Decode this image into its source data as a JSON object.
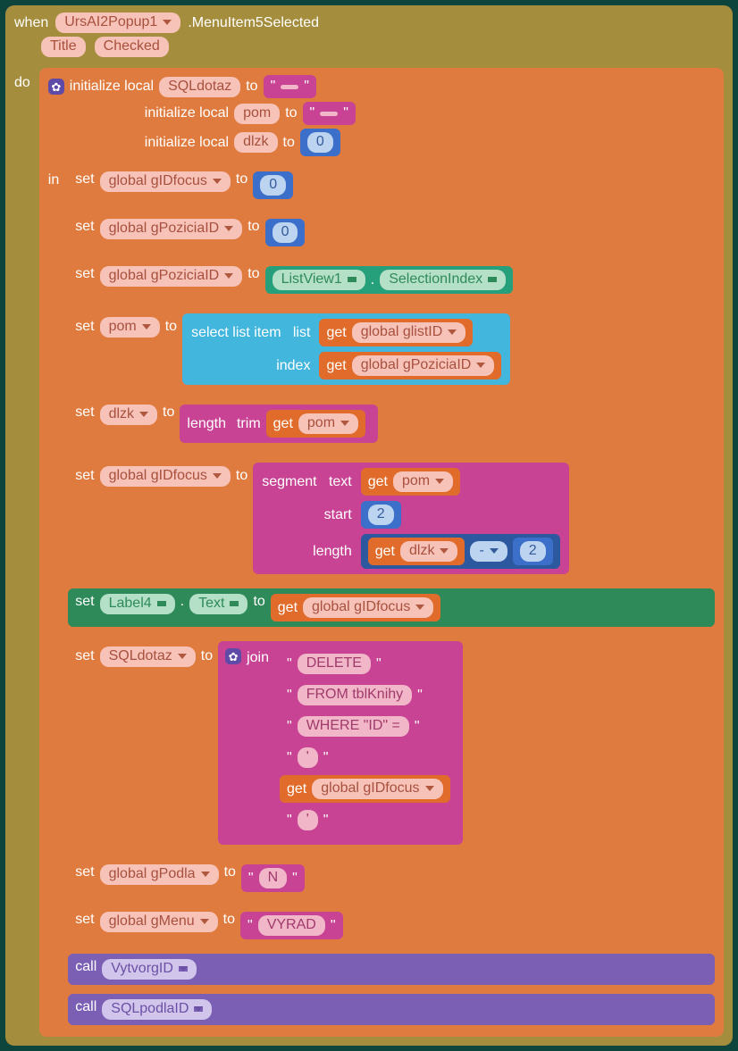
{
  "header": {
    "when": "when",
    "component": "UrsAI2Popup1",
    "event": ".MenuItem5Selected",
    "params": [
      "Title",
      "Checked"
    ],
    "do": "do"
  },
  "init": {
    "label": "initialize local",
    "to": "to",
    "in": "in",
    "vars": [
      {
        "name": "SQLdotaz",
        "value": " "
      },
      {
        "name": "pom",
        "value": " "
      },
      {
        "name": "dlzk",
        "value": "0"
      }
    ]
  },
  "stmts": {
    "set": "set",
    "to": "to",
    "call": "call",
    "get": "get",
    "gIDfocus": "global gIDfocus",
    "gPoziciaID": "global gPoziciaID",
    "glistID": "global glistID",
    "gPodla": "global gPodla",
    "gMenu": "global gMenu",
    "pom": "pom",
    "dlzk": "dlzk",
    "SQLdotaz": "SQLdotaz",
    "zero": "0",
    "two": "2",
    "minus": "-",
    "ListView1": "ListView1",
    "dot": ".",
    "SelectionIndex": "SelectionIndex",
    "selectListItem": "select list item",
    "list": "list",
    "index": "index",
    "length": "length",
    "trim": "trim",
    "segment": "segment",
    "text": "text",
    "start": "start",
    "lengthLbl": "length",
    "Label4": "Label4",
    "Text": "Text",
    "join": "join",
    "joinItems": {
      "a": "DELETE ",
      "b": " FROM tblKnihy ",
      "c": " WHERE \"ID\"  = ",
      "d": "'",
      "e": "'"
    },
    "N": "N",
    "VYRAD": "VYRAD",
    "VytvorgID": "VytvorgID",
    "SQLpodlaID": "SQLpodlaID",
    "quote": "\""
  }
}
